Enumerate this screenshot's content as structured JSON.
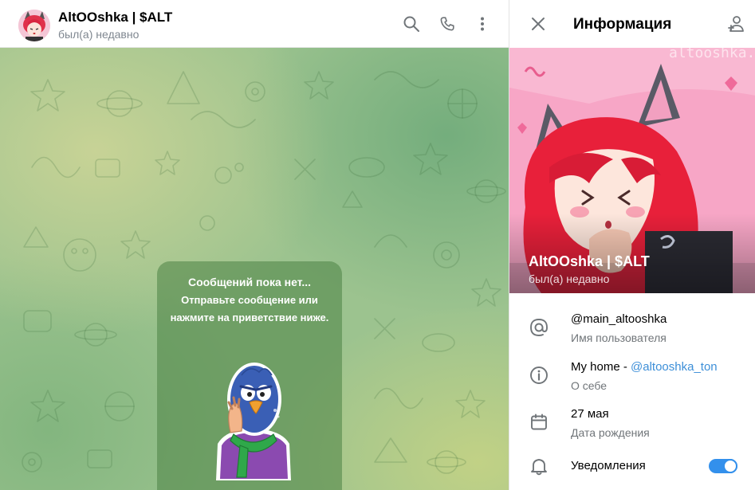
{
  "chat": {
    "title": "AltOOshka | $ALT",
    "status": "был(а) недавно",
    "empty_title": "Сообщений пока нет...",
    "empty_text": "Отправьте сообщение или нажмите на приветствие ниже."
  },
  "info": {
    "title": "Информация",
    "name": "AltOOshka | $ALT",
    "status": "был(а) недавно",
    "watermark": "altooshka.j",
    "username": "@main_altooshka",
    "username_label": "Имя пользователя",
    "bio_prefix": "My home - ",
    "bio_link": "@altooshka_ton",
    "bio_label": "О себе",
    "birthday": "27 мая",
    "birthday_label": "Дата рождения",
    "notifications_label": "Уведомления",
    "notifications_on": true
  },
  "colors": {
    "accent": "#3390ec",
    "link": "#3d8fd8",
    "muted": "#707579"
  },
  "icons": {
    "search": "search-icon",
    "call": "phone-icon",
    "more": "more-vertical-icon",
    "close": "close-icon",
    "add_contact": "add-contact-icon",
    "username": "at-sign-icon",
    "bio": "info-icon",
    "birthday": "calendar-icon",
    "notifications": "bell-icon"
  }
}
